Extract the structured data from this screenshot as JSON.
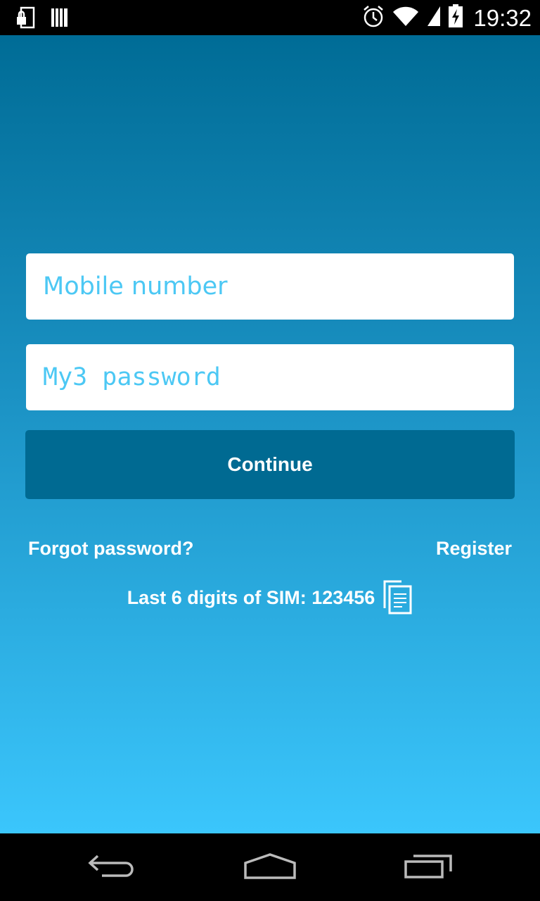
{
  "status_bar": {
    "time": "19:32",
    "left_icons": [
      "lock-screen-icon",
      "barcode-icon"
    ],
    "right_icons": [
      "alarm-icon",
      "wifi-icon",
      "signal-icon",
      "battery-charging-icon"
    ]
  },
  "login": {
    "mobile_placeholder": "Mobile number",
    "password_placeholder": "My3 password",
    "continue_label": "Continue",
    "forgot_label": "Forgot password?",
    "register_label": "Register",
    "sim_text": "Last 6 digits of SIM: 123456",
    "sim_copy_icon": "copy-icon"
  },
  "nav_bar": {
    "icons": [
      "back-icon",
      "home-icon",
      "recent-apps-icon"
    ]
  },
  "colors": {
    "gradient_top": "#006c96",
    "gradient_bottom": "#3bc6fc",
    "button": "#006a92",
    "placeholder": "#4cc8f4"
  }
}
